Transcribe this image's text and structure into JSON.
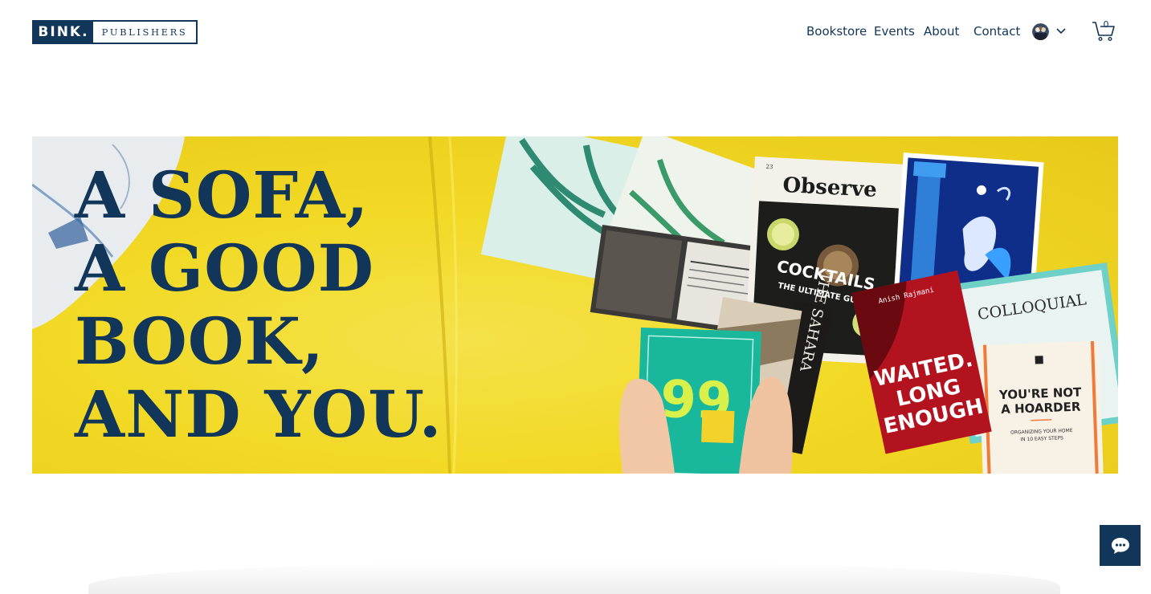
{
  "header": {
    "logo_primary": "BINK.",
    "logo_secondary": "PUBLISHERS",
    "nav": [
      {
        "label": "Bookstore"
      },
      {
        "label": "Events"
      },
      {
        "label": "About"
      },
      {
        "label": "Contact"
      }
    ],
    "cart_count": "0",
    "icons": [
      "avatar",
      "chevron-down-icon",
      "cart-icon"
    ]
  },
  "hero": {
    "headline_lines": [
      "A SOFA,",
      "A GOOD",
      "BOOK,",
      "AND YOU."
    ],
    "books": {
      "observe_title": "Observe",
      "cocktails_title": "COCKTAILS",
      "cocktails_subtitle": "THE ULTIMATE GUIDE",
      "sahara_title": "THE SAHARA",
      "waited_author": "Anish Rajmani",
      "waited_title": [
        "WAITED.",
        "LONG",
        "ENOUGH"
      ],
      "colloquial_title": "COLLOQUIAL",
      "hoarder_title": [
        "YOU'RE NOT",
        "A HOARDER"
      ],
      "hoarder_subtitle": [
        "ORGANIZING YOUR HOME",
        "IN 10 EASY STEPS"
      ],
      "green_book_number": "99",
      "page_number": "23"
    }
  },
  "chat": {
    "icon": "chat-bubble-icon"
  },
  "colors": {
    "brand_navy": "#12365a",
    "hero_yellow": "#f2d925"
  }
}
